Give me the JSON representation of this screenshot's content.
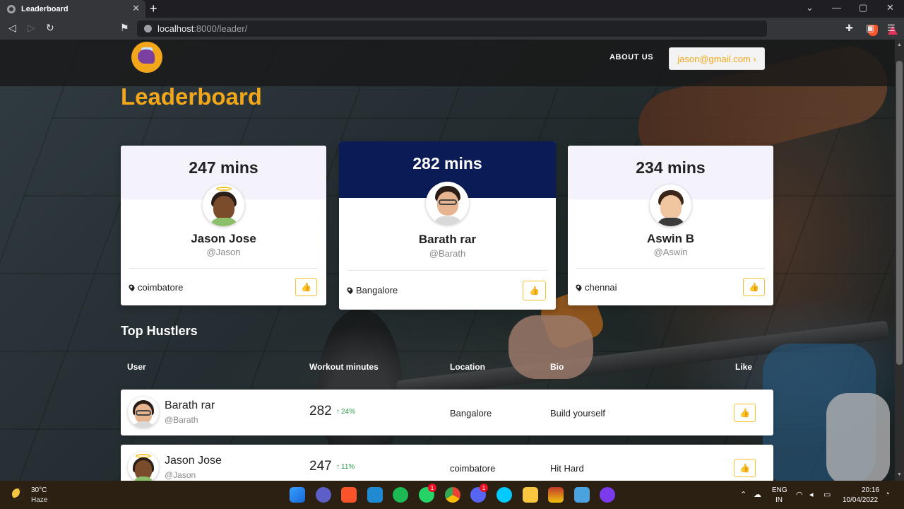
{
  "browser": {
    "tab_title": "Leaderboard",
    "tab_close": "✕",
    "new_tab": "+",
    "url_host": "localhost",
    "url_path": ":8000/leader/",
    "window_controls": [
      "⌄",
      "—",
      "▢",
      "✕"
    ]
  },
  "site": {
    "nav_about": "ABOUT US",
    "user_email": "jason@gmail.com ›",
    "page_title": "Leaderboard",
    "accent_color": "#f2a71b",
    "featured_color": "#0b1b55"
  },
  "podium": [
    {
      "minutes": "247 mins",
      "name": "Jason Jose",
      "handle": "@Jason",
      "location": "coimbatore"
    },
    {
      "minutes": "282 mins",
      "name": "Barath rar",
      "handle": "@Barath",
      "location": "Bangalore"
    },
    {
      "minutes": "234 mins",
      "name": "Aswin B",
      "handle": "@Aswin",
      "location": "chennai"
    }
  ],
  "hustlers": {
    "title": "Top Hustlers",
    "columns": [
      "User",
      "Workout minutes",
      "Location",
      "Bio",
      "Like"
    ],
    "rows": [
      {
        "name": "Barath rar",
        "handle": "@Barath",
        "minutes": "282",
        "trend": "24%",
        "location": "Bangalore",
        "bio": "Build yourself"
      },
      {
        "name": "Jason Jose",
        "handle": "@Jason",
        "minutes": "247",
        "trend": "11%",
        "location": "coimbatore",
        "bio": "Hit Hard"
      }
    ]
  },
  "like_icon": "thumbs-up-icon",
  "taskbar": {
    "temperature": "30°C",
    "weather": "Haze",
    "lang_line1": "ENG",
    "lang_line2": "IN",
    "time": "20:16",
    "date": "10/04/2022",
    "whatsapp_badge": "1",
    "discord_badge": "1"
  }
}
